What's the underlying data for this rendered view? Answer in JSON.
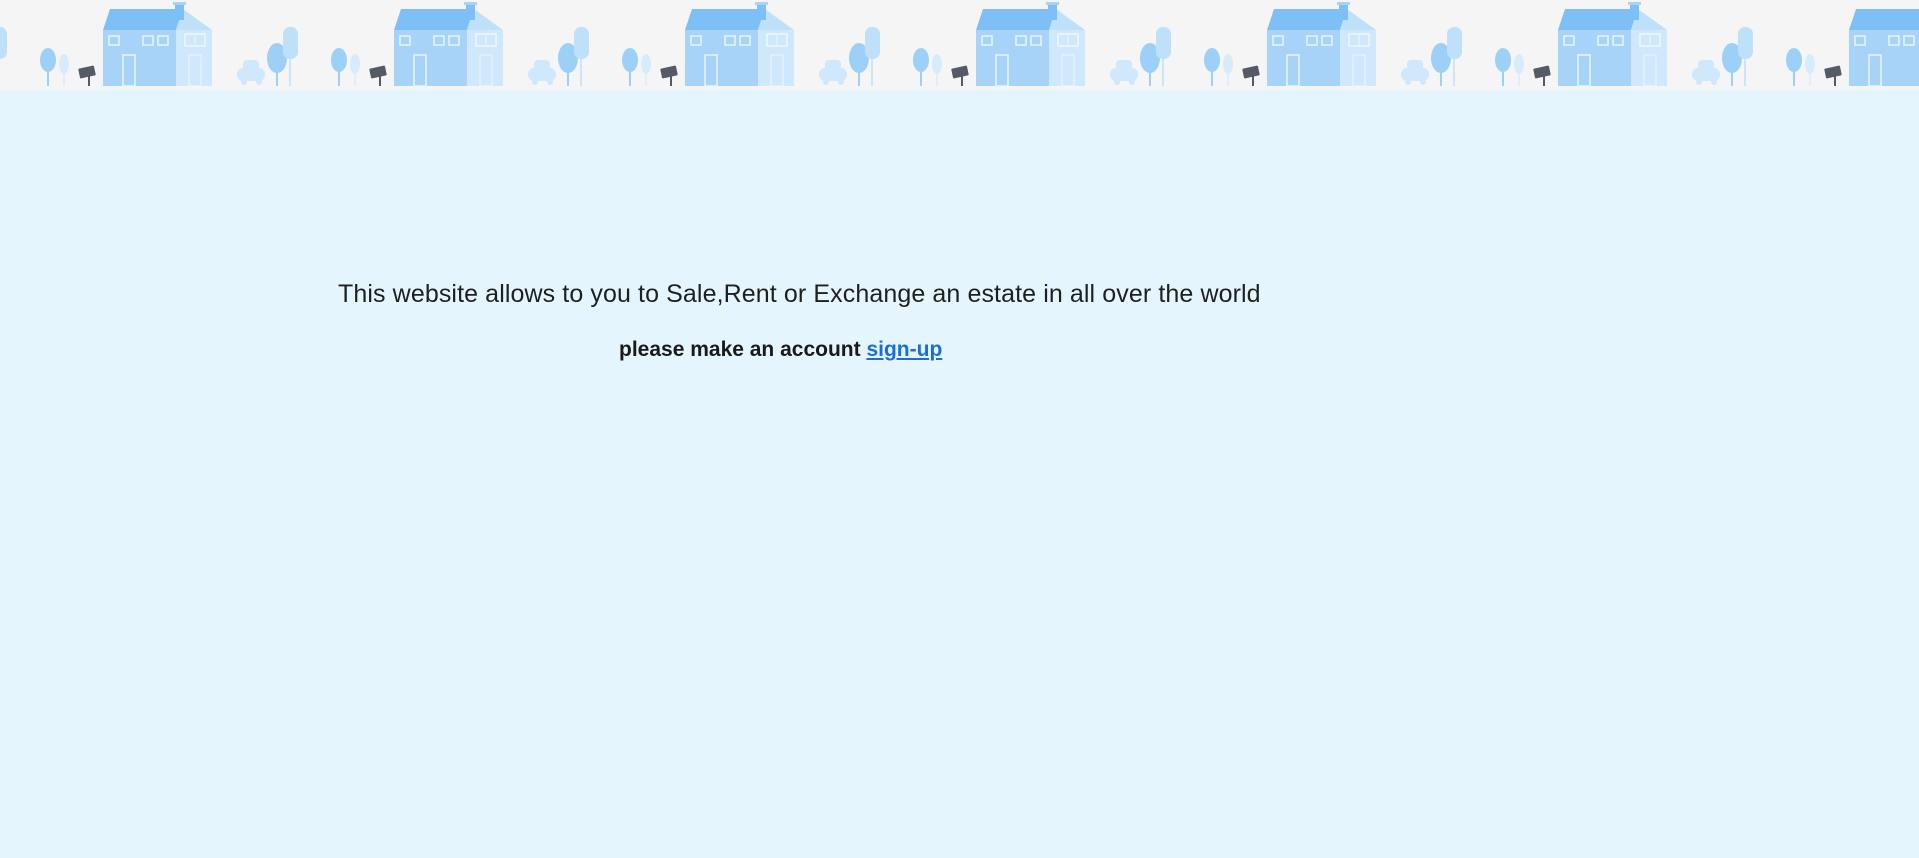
{
  "banner": {
    "icon": "house-row-illustration",
    "colors": {
      "background": "#f5f5f5",
      "house": "#a6d3f7",
      "roof": "#7ec0f6",
      "tree": "#9dd0f6",
      "sign": "#555a66"
    }
  },
  "main": {
    "intro": "This website allows to you to Sale,Rent or Exchange an estate in all over the world",
    "cta_prefix": "please make an account",
    "signup_link": "sign-up"
  },
  "colors": {
    "page_background": "#e5f5fd",
    "link": "#1a6fd6"
  }
}
